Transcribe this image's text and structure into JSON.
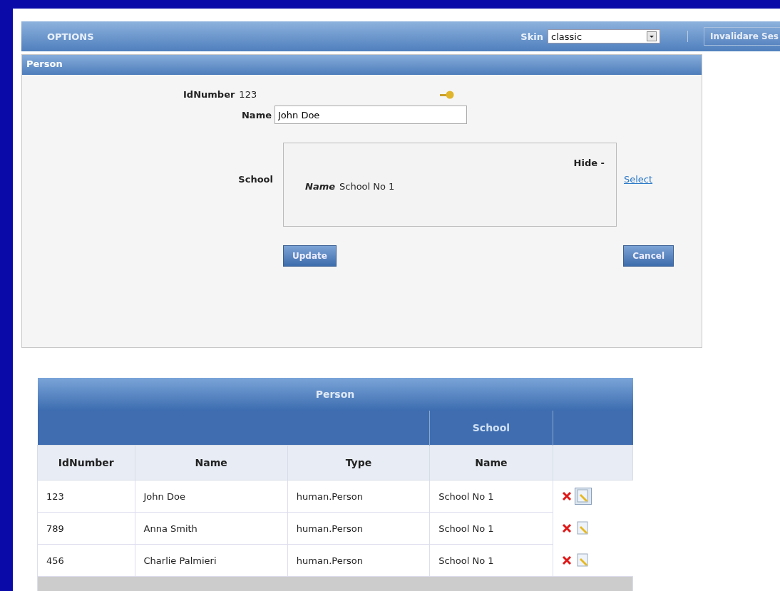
{
  "options_bar": {
    "title": "OPTIONS",
    "skin_label": "Skin",
    "skin_value": "classic",
    "invalidate_button": "Invalidare Ses"
  },
  "person_form": {
    "title": "Person",
    "id_label": "IdNumber",
    "id_value": "123",
    "name_label": "Name",
    "name_value": "John Doe",
    "school_label": "School",
    "hide_link": "Hide -",
    "school_name_label": "Name",
    "school_name_value": "School No 1",
    "select_link": "Select",
    "update_button": "Update",
    "cancel_button": "Cancel"
  },
  "table": {
    "title": "Person",
    "group_header": "School",
    "columns": [
      "IdNumber",
      "Name",
      "Type",
      "Name"
    ],
    "rows": [
      {
        "cells": [
          "123",
          "John Doe",
          "human.Person",
          "School No 1"
        ],
        "selected": true
      },
      {
        "cells": [
          "789",
          "Anna Smith",
          "human.Person",
          "School No 1"
        ],
        "selected": false
      },
      {
        "cells": [
          "456",
          "Charlie Palmieri",
          "human.Person",
          "School No 1"
        ],
        "selected": false
      }
    ]
  }
}
